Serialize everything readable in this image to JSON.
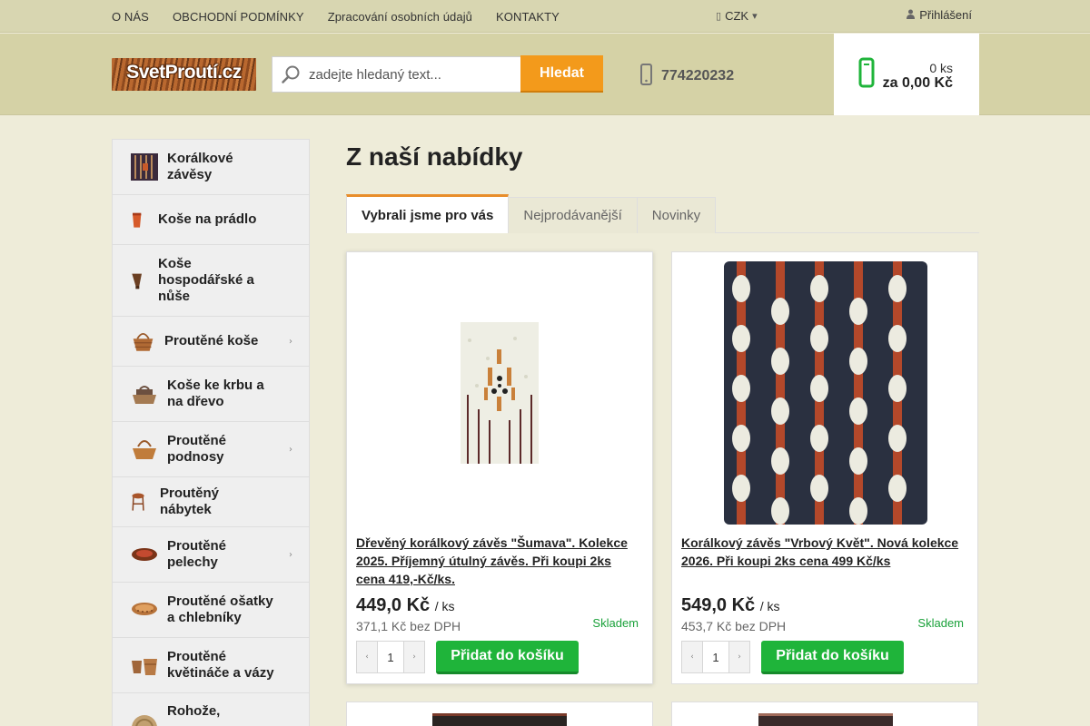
{
  "topnav": {
    "links": [
      "O NÁS",
      "OBCHODNÍ PODMÍNKY",
      "Zpracování osobních údajů",
      "KONTAKTY"
    ],
    "currency": "CZK",
    "login": "Přihlášení"
  },
  "header": {
    "logo_text": "SvetProutí.cz",
    "search_placeholder": "zadejte hledaný text...",
    "search_button": "Hledat",
    "phone": "774220232",
    "cart_count": "0 ks",
    "cart_total": "za 0,00 Kč"
  },
  "sidebar": {
    "categories": [
      {
        "label": "Korálkové závěsy",
        "has_submenu": false
      },
      {
        "label": "Koše na prádlo",
        "has_submenu": false
      },
      {
        "label": "Koše hospodářské a nůše",
        "has_submenu": false
      },
      {
        "label": "Proutěné koše",
        "has_submenu": true
      },
      {
        "label": "Koše ke krbu a na dřevo",
        "has_submenu": false
      },
      {
        "label": "Proutěné podnosy",
        "has_submenu": true
      },
      {
        "label": "Proutěný nábytek",
        "has_submenu": false
      },
      {
        "label": "Proutěné pelechy",
        "has_submenu": true
      },
      {
        "label": "Proutěné ošatky a chlebníky",
        "has_submenu": false
      },
      {
        "label": "Proutěné květináče a vázy",
        "has_submenu": false
      },
      {
        "label": "Rohože,",
        "has_submenu": false
      }
    ]
  },
  "main": {
    "title": "Z naší nabídky",
    "tabs": [
      "Vybrali jsme pro vás",
      "Nejprodávanější",
      "Novinky"
    ],
    "active_tab": "Vybrali jsme pro vás"
  },
  "products": [
    {
      "name": "Dřevěný korálkový závěs \"Šumava\". Kolekce 2025. Příjemný útulný závěs. Při koupi 2ks cena 419,-Kč/ks.",
      "price": "449,0 Kč",
      "unit": "/ ks",
      "netto": "371,1 Kč bez DPH",
      "stock": "Skladem",
      "qty": "1",
      "add_label": "Přidat do košíku"
    },
    {
      "name": "Korálkový závěs \"Vrbový Květ\". Nová kolekce 2026. Při koupi 2ks cena 499 Kč/ks",
      "price": "549,0 Kč",
      "unit": "/ ks",
      "netto": "453,7 Kč bez DPH",
      "stock": "Skladem",
      "qty": "1",
      "add_label": "Přidat do košíku"
    }
  ],
  "colors": {
    "accent_orange": "#f39a1b",
    "add_green": "#1fb43a",
    "stock_green": "#1aa13a",
    "header_bg": "#d5d2a6"
  },
  "icons": {
    "search": "magnifier-icon",
    "phone": "phone-icon",
    "cart": "shopping-cart-icon",
    "user": "user-icon",
    "submenu": "chevron-right-icon"
  }
}
